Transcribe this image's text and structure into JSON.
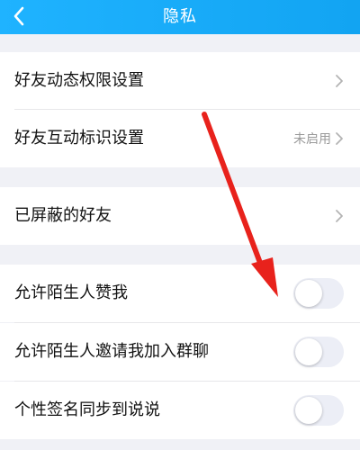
{
  "header": {
    "title": "隐私"
  },
  "rows": {
    "friend_feed_permission": {
      "label": "好友动态权限设置"
    },
    "friend_interaction_badge": {
      "label": "好友互动标识设置",
      "value": "未启用"
    },
    "blocked_friends": {
      "label": "已屏蔽的好友"
    },
    "allow_stranger_like": {
      "label": "允许陌生人赞我",
      "enabled": false
    },
    "allow_stranger_group_invite": {
      "label": "允许陌生人邀请我加入群聊",
      "enabled": false
    },
    "sync_signature_to_moments": {
      "label": "个性签名同步到说说",
      "enabled": false
    }
  },
  "colors": {
    "header": "#12a4f2",
    "toggle_off": "#eceef6",
    "annotation_arrow": "#e8221c"
  }
}
